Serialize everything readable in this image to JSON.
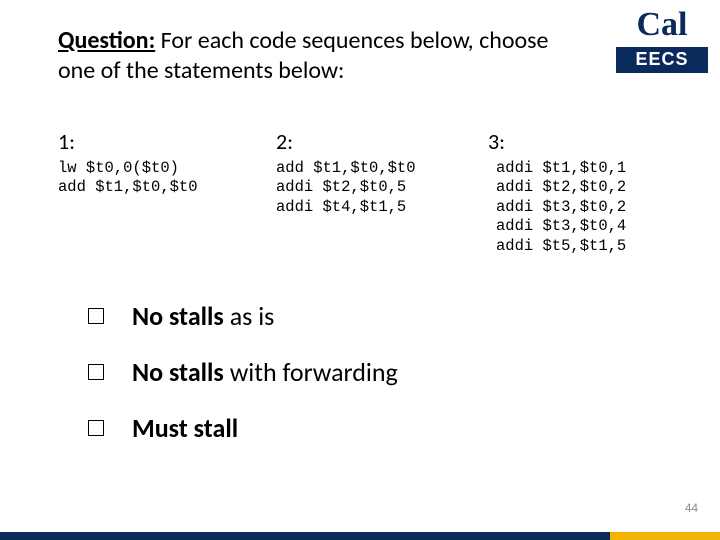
{
  "title": {
    "question_label": "Question:",
    "rest": "  For each code sequences below, choose one of the statements below:"
  },
  "logo": {
    "script": "Cal",
    "bar": "EECS"
  },
  "columns": [
    {
      "label": "1:",
      "code": "lw $t0,0($t0)\nadd $t1,$t0,$t0"
    },
    {
      "label": "2:",
      "code": "add $t1,$t0,$t0\naddi $t2,$t0,5\naddi $t4,$t1,5"
    },
    {
      "label": "3:",
      "code": "addi $t1,$t0,1\naddi $t2,$t0,2\naddi $t3,$t0,2\naddi $t3,$t0,4\naddi $t5,$t1,5"
    }
  ],
  "options": [
    {
      "bold": "No stalls",
      "rest": " as is"
    },
    {
      "bold": "No stalls",
      "rest": " with forwarding"
    },
    {
      "bold": "Must stall",
      "rest": ""
    }
  ],
  "page_number": "44"
}
